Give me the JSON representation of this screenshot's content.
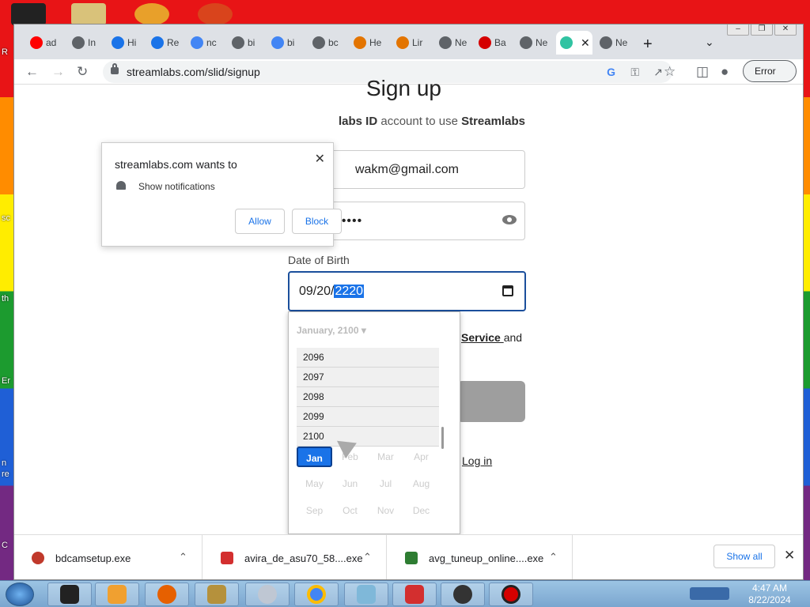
{
  "desktop": {
    "fragments": [
      "R",
      "sc",
      "th",
      "Er",
      "n",
      "re",
      "C"
    ]
  },
  "browser": {
    "tabs": [
      {
        "label": "ad",
        "icon": "youtube-icon",
        "color": "#ff0000"
      },
      {
        "label": "In",
        "icon": "globe-icon",
        "color": "#5f6368"
      },
      {
        "label": "Hi",
        "icon": "history-icon",
        "color": "#1a73e8"
      },
      {
        "label": "Re",
        "icon": "hash-icon",
        "color": "#1a73e8"
      },
      {
        "label": "nc",
        "icon": "google-icon",
        "color": "#4285f4"
      },
      {
        "label": "bi",
        "icon": "globe-icon",
        "color": "#5f6368"
      },
      {
        "label": "bi",
        "icon": "google-icon",
        "color": "#4285f4"
      },
      {
        "label": "bc",
        "icon": "globe-icon",
        "color": "#5f6368"
      },
      {
        "label": "He",
        "icon": "tools-icon",
        "color": "#e37400"
      },
      {
        "label": "Lir",
        "icon": "tools-icon",
        "color": "#e37400"
      },
      {
        "label": "Ne",
        "icon": "chrome-icon",
        "color": "#5f6368"
      },
      {
        "label": "Ba",
        "icon": "record-icon",
        "color": "#d50000"
      },
      {
        "label": "Ne",
        "icon": "chrome-icon",
        "color": "#5f6368"
      },
      {
        "label": "",
        "icon": "streamlabs-icon",
        "color": "#31c3a2",
        "active": true
      },
      {
        "label": "Ne",
        "icon": "chrome-icon",
        "color": "#5f6368"
      }
    ],
    "url": "streamlabs.com/slid/signup",
    "error_label": "Error"
  },
  "page": {
    "title": "Sign up",
    "subtitle_mid": "labs ID",
    "subtitle_tail": " account to use ",
    "subtitle_brand": "Streamlabs",
    "email_value": "wakm@gmail.com",
    "password_mask": "••••••••••••",
    "dob_label": "Date of Birth",
    "dob_prefix": "09/20/",
    "dob_year": "2220",
    "tos_link": "Service ",
    "tos_tail": "and",
    "login_link": "Log in"
  },
  "datepicker": {
    "header": "January, 2100 ▾",
    "years": [
      "2096",
      "2097",
      "2098",
      "2099",
      "2100"
    ],
    "months": [
      "Jan",
      "Feb",
      "Mar",
      "Apr",
      "May",
      "Jun",
      "Jul",
      "Aug",
      "Sep",
      "Oct",
      "Nov",
      "Dec"
    ],
    "selected_month": "Jan"
  },
  "notification_popup": {
    "title": "streamlabs.com wants to",
    "permission": "Show notifications",
    "allow_label": "Allow",
    "block_label": "Block"
  },
  "downloads": {
    "items": [
      {
        "name": "bdcamsetup.exe",
        "color": "#c0392b"
      },
      {
        "name": "avira_de_asu70_58....exe",
        "color": "#d32f2f"
      },
      {
        "name": "avg_tuneup_online....exe",
        "color": "#2e7d32"
      }
    ],
    "show_all_label": "Show all"
  },
  "taskbar": {
    "time": "4:47 AM",
    "date": "8/22/2024"
  }
}
